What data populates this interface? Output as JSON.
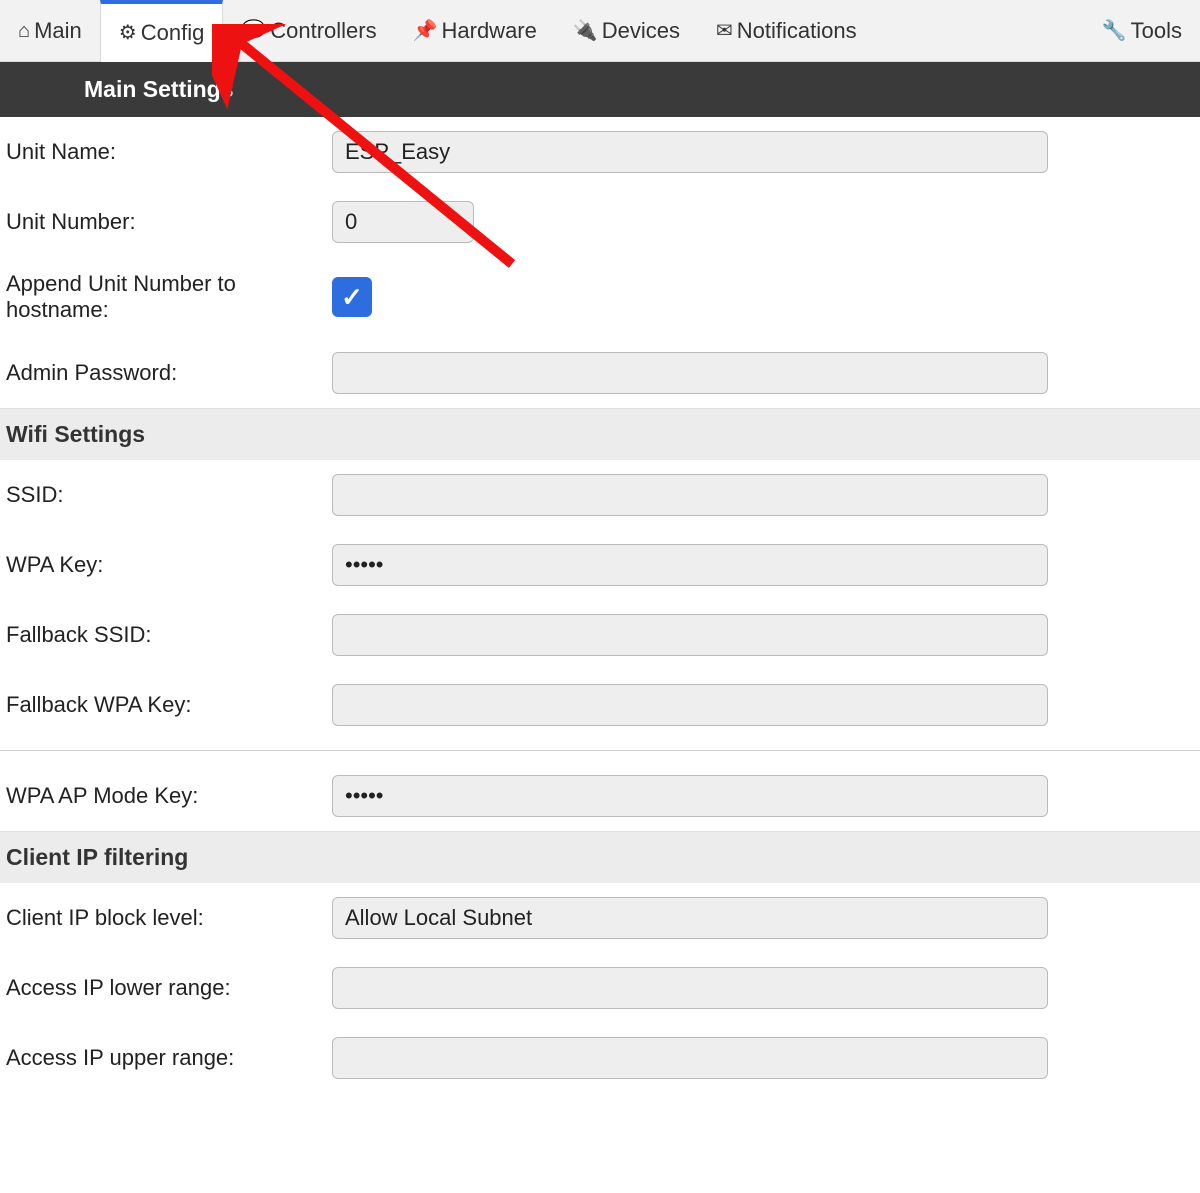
{
  "nav": {
    "tabs": [
      {
        "id": "main",
        "label": "Main",
        "icon": "⌂"
      },
      {
        "id": "config",
        "label": "Config",
        "icon": "⚙"
      },
      {
        "id": "controllers",
        "label": "Controllers",
        "icon": "💬"
      },
      {
        "id": "hardware",
        "label": "Hardware",
        "icon": "📌"
      },
      {
        "id": "devices",
        "label": "Devices",
        "icon": "🔌"
      },
      {
        "id": "notifications",
        "label": "Notifications",
        "icon": "✉"
      },
      {
        "id": "tools",
        "label": "Tools",
        "icon": "🔧"
      }
    ],
    "active": "config"
  },
  "sections": {
    "main": {
      "title": "Main Settings",
      "unit_name_label": "Unit Name:",
      "unit_name_value": "ESP_Easy",
      "unit_number_label": "Unit Number:",
      "unit_number_value": "0",
      "append_label": "Append Unit Number to hostname:",
      "append_checked": true,
      "admin_pw_label": "Admin Password:",
      "admin_pw_value": ""
    },
    "wifi": {
      "title": "Wifi Settings",
      "ssid_label": "SSID:",
      "ssid_value": "",
      "wpa_label": "WPA Key:",
      "wpa_value": "•••••",
      "fbssid_label": "Fallback SSID:",
      "fbssid_value": "",
      "fbwpa_label": "Fallback WPA Key:",
      "fbwpa_value": "",
      "apkey_label": "WPA AP Mode Key:",
      "apkey_value": "•••••"
    },
    "ipfilt": {
      "title": "Client IP filtering",
      "block_label": "Client IP block level:",
      "block_value": "Allow Local Subnet",
      "lower_label": "Access IP lower range:",
      "lower_value": "",
      "upper_label": "Access IP upper range:",
      "upper_value": ""
    }
  }
}
